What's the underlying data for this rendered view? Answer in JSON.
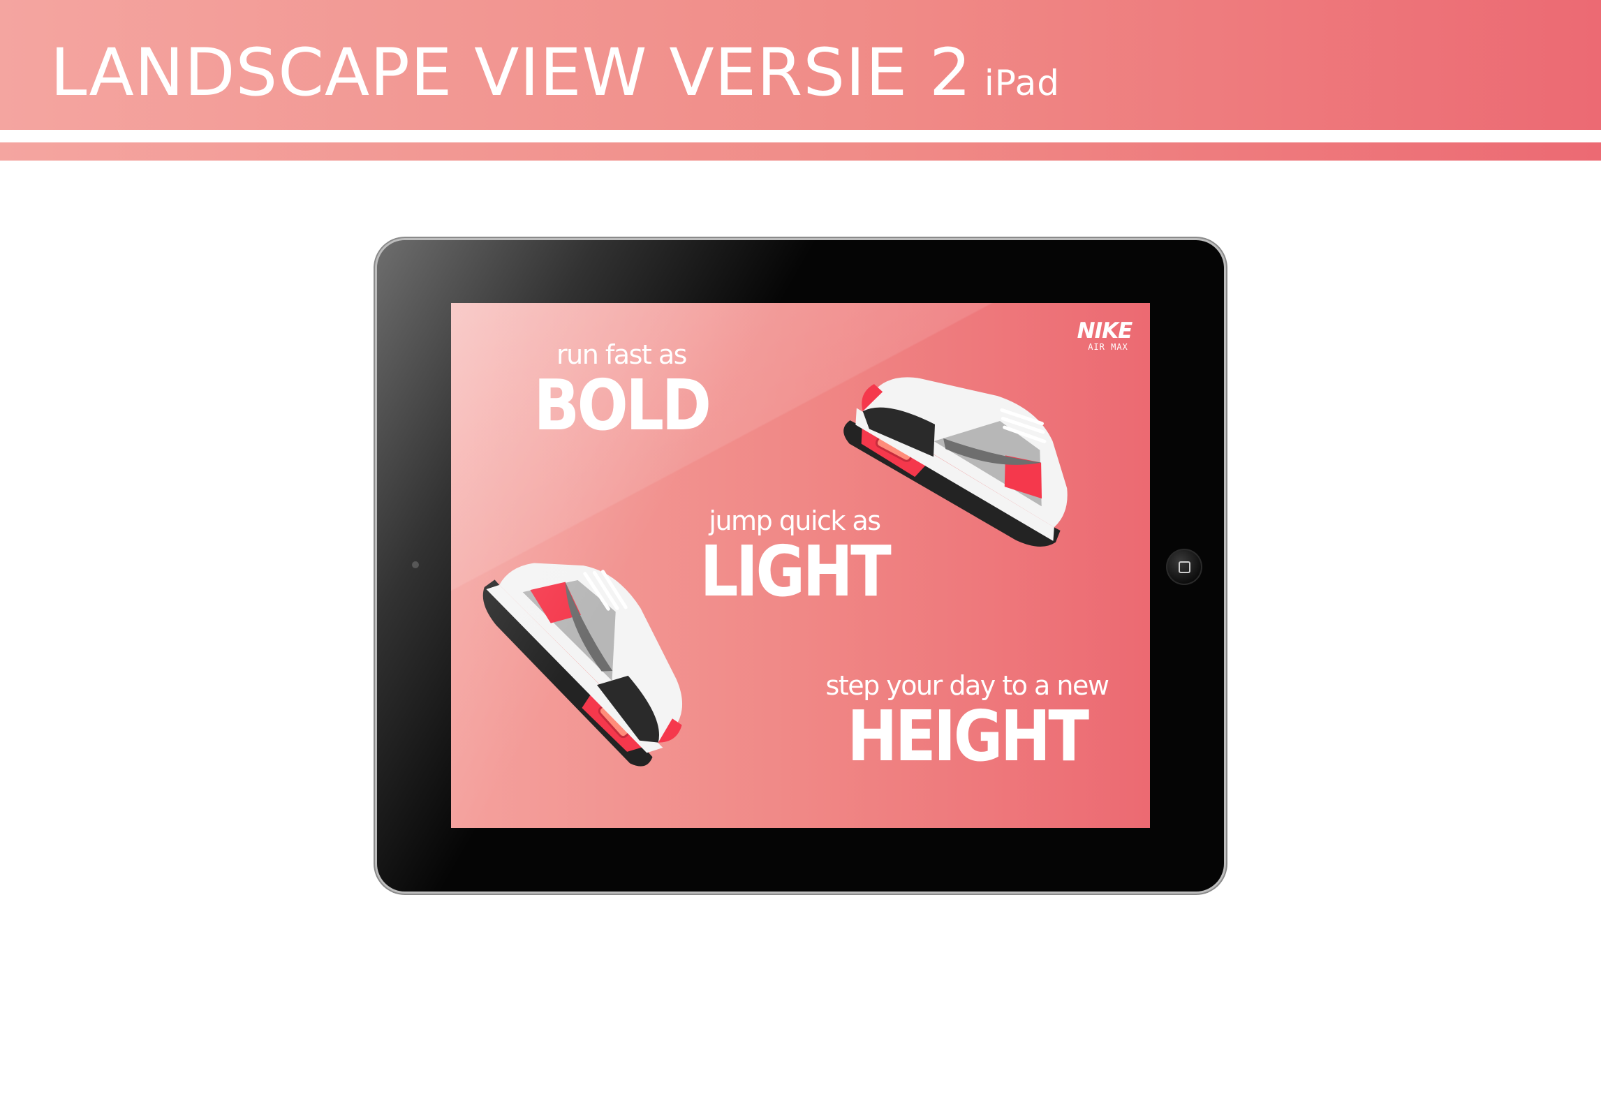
{
  "header": {
    "title": "LANDSCAPE VIEW VERSIE 2",
    "subtitle": "iPad"
  },
  "colors": {
    "banner_start": "#f4a5a0",
    "banner_end": "#ec6a73",
    "device_frame": "#050505",
    "screen_start": "#f4a19d",
    "screen_end": "#ec6a72",
    "text": "#ffffff",
    "shoe_accent": "#f5384c",
    "shoe_dark": "#232323",
    "shoe_grey": "#9a9a9a",
    "shoe_white": "#f4f4f4"
  },
  "device": {
    "type": "iPad",
    "orientation": "landscape",
    "home_button_icon": "home-square-icon"
  },
  "screen": {
    "brand": {
      "name": "NIKE",
      "model": "AIR MAX"
    },
    "taglines": [
      {
        "small": "run fast as",
        "big": "BOLD"
      },
      {
        "small": "jump quick as",
        "big": "LIGHT"
      },
      {
        "small": "step your day to a new",
        "big": "HEIGHT"
      }
    ],
    "images": [
      {
        "name": "sneaker-image",
        "description_icon": "air-max-sneaker"
      },
      {
        "name": "sneaker-image",
        "description_icon": "air-max-sneaker"
      }
    ]
  }
}
